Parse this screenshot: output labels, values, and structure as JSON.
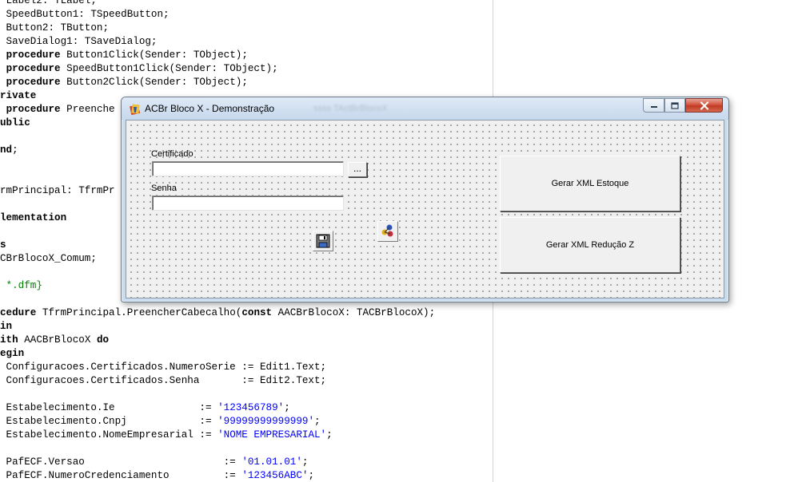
{
  "editor": {
    "lines": [
      {
        "text": " Label2: TLabel;",
        "style": "plain"
      },
      {
        "text": " SpeedButton1: TSpeedButton;",
        "style": "plain"
      },
      {
        "text": " Button2: TButton;",
        "style": "plain"
      },
      {
        "text": " SaveDialog1: TSaveDialog;",
        "style": "plain"
      },
      {
        "pre": " ",
        "kw": "procedure",
        "post": " Button1Click(Sender: TObject);",
        "style": "kw"
      },
      {
        "pre": " ",
        "kw": "procedure",
        "post": " SpeedButton1Click(Sender: TObject);",
        "style": "kw"
      },
      {
        "pre": " ",
        "kw": "procedure",
        "post": " Button2Click(Sender: TObject);",
        "style": "kw"
      },
      {
        "pre": "",
        "kw": "rivate",
        "post": "",
        "style": "kw"
      },
      {
        "pre": " ",
        "kw": "procedure",
        "post": " Preenche",
        "style": "kw"
      },
      {
        "pre": "",
        "kw": "ublic",
        "post": "",
        "style": "kw"
      },
      {
        "text": "",
        "style": "plain"
      },
      {
        "pre": "",
        "kw": "nd",
        "post": ";",
        "style": "kw"
      },
      {
        "text": "",
        "style": "plain"
      },
      {
        "text": "",
        "style": "plain"
      },
      {
        "text": "rmPrincipal: TfrmPr",
        "style": "plain"
      },
      {
        "text": "",
        "style": "plain"
      },
      {
        "pre": "",
        "kw": "lementation",
        "post": "",
        "style": "kw"
      },
      {
        "text": "",
        "style": "plain"
      },
      {
        "pre": "",
        "kw": "s",
        "post": "",
        "style": "kw"
      },
      {
        "text": "CBrBlocoX_Comum;",
        "style": "plain"
      },
      {
        "text": "",
        "style": "plain"
      },
      {
        "text": " *.dfm}",
        "style": "comment"
      },
      {
        "text": "",
        "style": "plain"
      },
      {
        "pre": "",
        "kw": "cedure",
        "post": " TfrmPrincipal.PreencherCabecalho(",
        "kw2": "const",
        "post2": " AACBrBlocoX: TACBrBlocoX);",
        "style": "kw"
      },
      {
        "pre": "",
        "kw": "in",
        "post": "",
        "style": "kw"
      },
      {
        "pre": "",
        "kw": "ith",
        "post": " AACBrBlocoX ",
        "kw2": "do",
        "post2": "",
        "style": "kw"
      },
      {
        "pre": "",
        "kw": "egin",
        "post": "",
        "style": "kw"
      },
      {
        "text": " Configuracoes.Certificados.NumeroSerie := Edit1.Text;",
        "style": "plain"
      },
      {
        "text": " Configuracoes.Certificados.Senha       := Edit2.Text;",
        "style": "plain"
      },
      {
        "text": "",
        "style": "plain"
      },
      {
        "pre": " Estabelecimento.Ie              := ",
        "str": "'123456789'",
        "post": ";",
        "style": "str"
      },
      {
        "pre": " Estabelecimento.Cnpj            := ",
        "str": "'99999999999999'",
        "post": ";",
        "style": "str"
      },
      {
        "pre": " Estabelecimento.NomeEmpresarial := ",
        "str": "'NOME EMPRESARIAL'",
        "post": ";",
        "style": "str"
      },
      {
        "text": "",
        "style": "plain"
      },
      {
        "pre": " PafECF.Versao                       := ",
        "str": "'01.01.01'",
        "post": ";",
        "style": "str"
      },
      {
        "pre": " PafECF.NumeroCredenciamento         := ",
        "str": "'123456ABC'",
        "post": ";",
        "style": "str"
      }
    ]
  },
  "window": {
    "title": "ACBr Bloco X - Demonstração",
    "title_ghost": "ssss TActBrBlocoX"
  },
  "form": {
    "label_certificado": "Certificado",
    "label_senha": "Senha",
    "edit_certificado_value": "",
    "edit_senha_value": "",
    "browse_button": "...",
    "gerar_estoque_button": "Gerar XML Estoque",
    "gerar_reducao_button": "Gerar XML Redução Z"
  },
  "icons": {
    "app": "delphi-app-icon",
    "save_dialog": "floppy-disk-icon",
    "bloco_x_component": "acbr-component-icon"
  }
}
